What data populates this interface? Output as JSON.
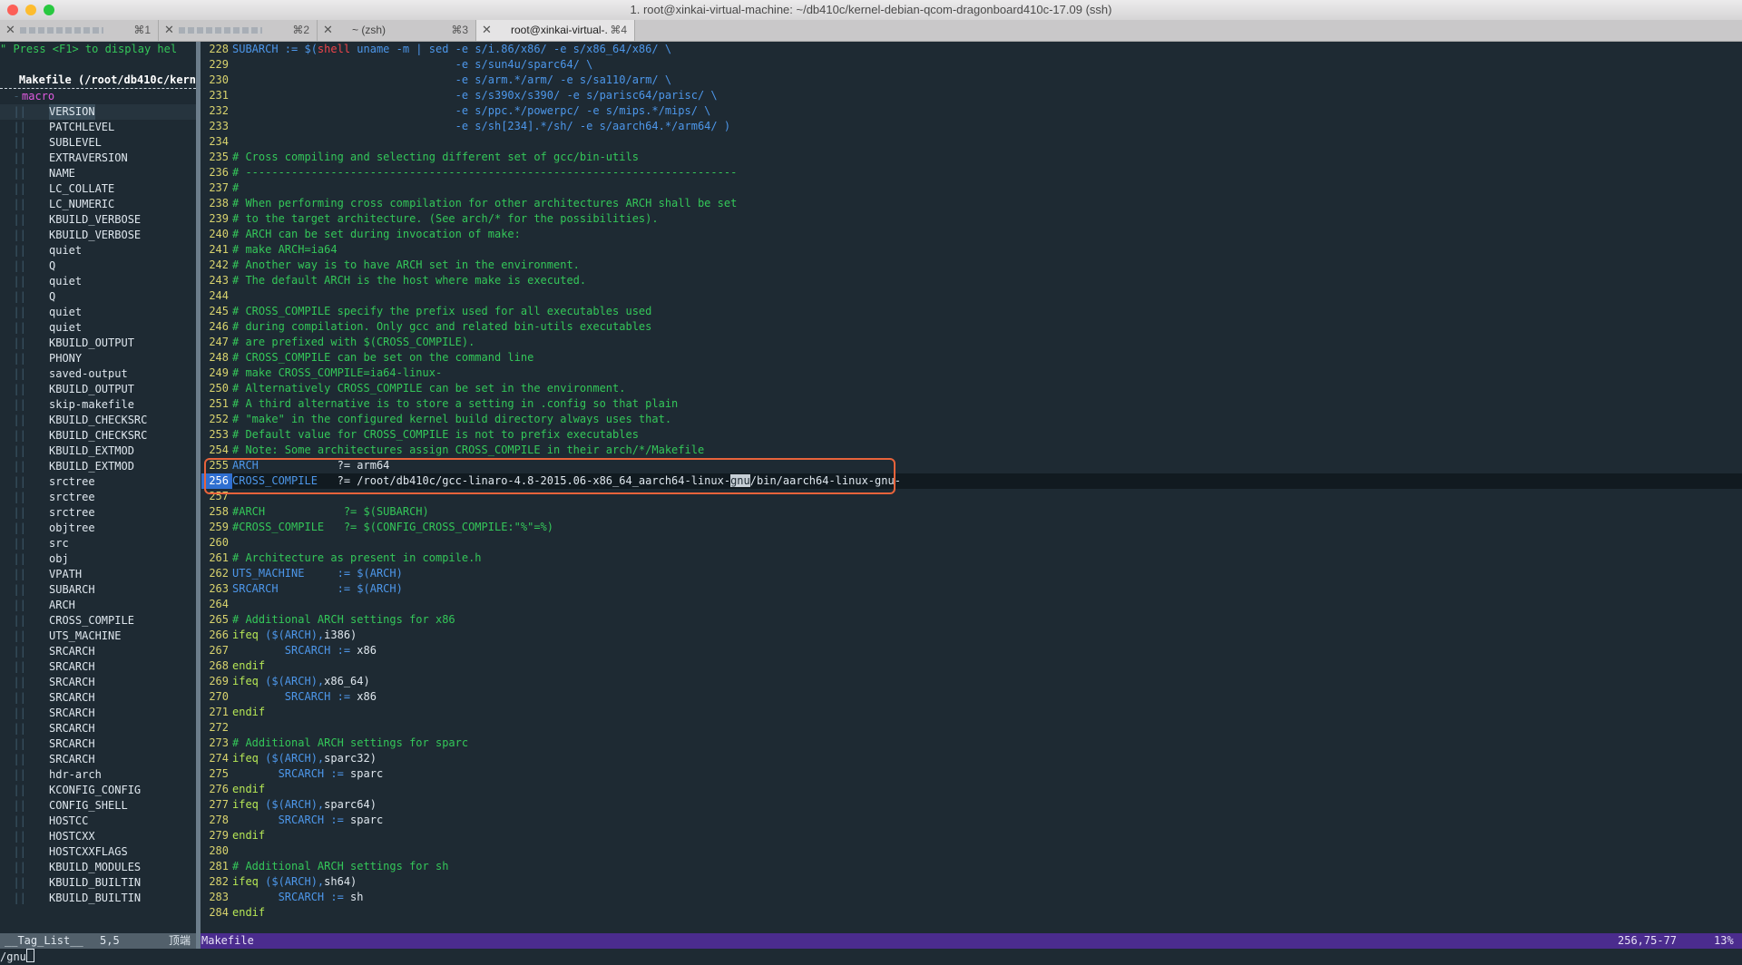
{
  "window": {
    "title": "1. root@xinkai-virtual-machine: ~/db410c/kernel-debian-qcom-dragonboard410c-17.09 (ssh)"
  },
  "tabs": [
    {
      "label": "",
      "shortcut": "⌘1",
      "active": false,
      "redacted": true
    },
    {
      "label": "",
      "shortcut": "⌘2",
      "active": false,
      "redacted": true
    },
    {
      "label": "~ (zsh)",
      "shortcut": "⌘3",
      "active": false,
      "redacted": false
    },
    {
      "label": "root@xinkai-virtual-...",
      "shortcut": "⌘4",
      "active": true,
      "redacted": false
    }
  ],
  "taglist": {
    "help": "\" Press <F1> to display hel",
    "file": "Makefile (/root/db410c/kern",
    "group": "macro",
    "items": [
      "VERSION",
      "PATCHLEVEL",
      "SUBLEVEL",
      "EXTRAVERSION",
      "NAME",
      "LC_COLLATE",
      "LC_NUMERIC",
      "KBUILD_VERBOSE",
      "KBUILD_VERBOSE",
      "quiet",
      "Q",
      "quiet",
      "Q",
      "quiet",
      "quiet",
      "KBUILD_OUTPUT",
      "PHONY",
      "saved-output",
      "KBUILD_OUTPUT",
      "skip-makefile",
      "KBUILD_CHECKSRC",
      "KBUILD_CHECKSRC",
      "KBUILD_EXTMOD",
      "KBUILD_EXTMOD",
      "srctree",
      "srctree",
      "srctree",
      "objtree",
      "src",
      "obj",
      "VPATH",
      "SUBARCH",
      "ARCH",
      "CROSS_COMPILE",
      "UTS_MACHINE",
      "SRCARCH",
      "SRCARCH",
      "SRCARCH",
      "SRCARCH",
      "SRCARCH",
      "SRCARCH",
      "SRCARCH",
      "SRCARCH",
      "hdr-arch",
      "KCONFIG_CONFIG",
      "CONFIG_SHELL",
      "HOSTCC",
      "HOSTCXX",
      "HOSTCXXFLAGS",
      "KBUILD_MODULES",
      "KBUILD_BUILTIN",
      "KBUILD_BUILTIN"
    ],
    "selected_index": 0
  },
  "editor": {
    "current_line": 256,
    "lines": [
      {
        "n": "228",
        "segs": [
          [
            "SUBARCH := $(",
            "#4d97ea"
          ],
          [
            "shell",
            "#f0444a"
          ],
          [
            " uname -m | sed -e s/i.86/x86/ -e s/x86_64/x86/ \\",
            "#4d97ea"
          ]
        ]
      },
      {
        "n": "229",
        "segs": [
          [
            "                                  -e s/sun4u/sparc64/ \\",
            "#4d97ea"
          ]
        ]
      },
      {
        "n": "230",
        "segs": [
          [
            "                                  -e s/arm.*/arm/ -e s/sa110/arm/ \\",
            "#4d97ea"
          ]
        ]
      },
      {
        "n": "231",
        "segs": [
          [
            "                                  -e s/s390x/s390/ -e s/parisc64/parisc/ \\",
            "#4d97ea"
          ]
        ]
      },
      {
        "n": "232",
        "segs": [
          [
            "                                  -e s/ppc.*/powerpc/ -e s/mips.*/mips/ \\",
            "#4d97ea"
          ]
        ]
      },
      {
        "n": "233",
        "segs": [
          [
            "                                  -e s/sh[234].*/sh/ -e s/aarch64.*/arm64/ )",
            "#4d97ea"
          ]
        ]
      },
      {
        "n": "234",
        "segs": []
      },
      {
        "n": "235",
        "segs": [
          [
            "# Cross compiling and selecting different set of gcc/bin-utils",
            "#34c759"
          ]
        ]
      },
      {
        "n": "236",
        "segs": [
          [
            "# ---------------------------------------------------------------------------",
            "#34c759"
          ]
        ]
      },
      {
        "n": "237",
        "segs": [
          [
            "#",
            "#34c759"
          ]
        ]
      },
      {
        "n": "238",
        "segs": [
          [
            "# When performing cross compilation for other architectures ARCH shall be set",
            "#34c759"
          ]
        ]
      },
      {
        "n": "239",
        "segs": [
          [
            "# to the target architecture. (See arch/* for the possibilities).",
            "#34c759"
          ]
        ]
      },
      {
        "n": "240",
        "segs": [
          [
            "# ARCH can be set during invocation of make:",
            "#34c759"
          ]
        ]
      },
      {
        "n": "241",
        "segs": [
          [
            "# make ARCH=ia64",
            "#34c759"
          ]
        ]
      },
      {
        "n": "242",
        "segs": [
          [
            "# Another way is to have ARCH set in the environment.",
            "#34c759"
          ]
        ]
      },
      {
        "n": "243",
        "segs": [
          [
            "# The default ARCH is the host where make is executed.",
            "#34c759"
          ]
        ]
      },
      {
        "n": "244",
        "segs": []
      },
      {
        "n": "245",
        "segs": [
          [
            "# CROSS_COMPILE specify the prefix used for all executables used",
            "#34c759"
          ]
        ]
      },
      {
        "n": "246",
        "segs": [
          [
            "# during compilation. Only gcc and related bin-utils executables",
            "#34c759"
          ]
        ]
      },
      {
        "n": "247",
        "segs": [
          [
            "# are prefixed with $(CROSS_COMPILE).",
            "#34c759"
          ]
        ]
      },
      {
        "n": "248",
        "segs": [
          [
            "# CROSS_COMPILE can be set on the command line",
            "#34c759"
          ]
        ]
      },
      {
        "n": "249",
        "segs": [
          [
            "# make CROSS_COMPILE=ia64-linux-",
            "#34c759"
          ]
        ]
      },
      {
        "n": "250",
        "segs": [
          [
            "# Alternatively CROSS_COMPILE can be set in the environment.",
            "#34c759"
          ]
        ]
      },
      {
        "n": "251",
        "segs": [
          [
            "# A third alternative is to store a setting in .config so that plain",
            "#34c759"
          ]
        ]
      },
      {
        "n": "252",
        "segs": [
          [
            "# \"make\" in the configured kernel build directory always uses that.",
            "#34c759"
          ]
        ]
      },
      {
        "n": "253",
        "segs": [
          [
            "# Default value for CROSS_COMPILE is not to prefix executables",
            "#34c759"
          ]
        ]
      },
      {
        "n": "254",
        "segs": [
          [
            "# Note: Some architectures assign CROSS_COMPILE in their arch/*/Makefile",
            "#34c759"
          ]
        ]
      },
      {
        "n": "255",
        "segs": [
          [
            "ARCH",
            "#4d97ea"
          ],
          [
            "            ?= arm64",
            "#dfe7ee"
          ]
        ]
      },
      {
        "n": "256",
        "segs": [
          [
            "CROSS_COMPILE",
            "#4d97ea"
          ],
          [
            "   ?= /root/db410c/gcc-linaro-4.8-2015.06-x86_64_aarch64-linux-",
            "#dfe7ee"
          ],
          [
            "gnu",
            "#1e2a33",
            "#c7cfd6"
          ],
          [
            "/bin/aarch64-linux-gnu-",
            "#dfe7ee"
          ]
        ]
      },
      {
        "n": "257",
        "segs": []
      },
      {
        "n": "258",
        "segs": [
          [
            "#ARCH            ?= $(SUBARCH)",
            "#34c759"
          ]
        ]
      },
      {
        "n": "259",
        "segs": [
          [
            "#CROSS_COMPILE   ?= $(CONFIG_CROSS_COMPILE:\"%\"=%)",
            "#34c759"
          ]
        ]
      },
      {
        "n": "260",
        "segs": []
      },
      {
        "n": "261",
        "segs": [
          [
            "# Architecture as present in compile.h",
            "#34c759"
          ]
        ]
      },
      {
        "n": "262",
        "segs": [
          [
            "UTS_MACHINE     := $(ARCH)",
            "#4d97ea"
          ]
        ]
      },
      {
        "n": "263",
        "segs": [
          [
            "SRCARCH         := $(ARCH)",
            "#4d97ea"
          ]
        ]
      },
      {
        "n": "264",
        "segs": []
      },
      {
        "n": "265",
        "segs": [
          [
            "# Additional ARCH settings for x86",
            "#34c759"
          ]
        ]
      },
      {
        "n": "266",
        "segs": [
          [
            "ifeq",
            "#b5e655"
          ],
          [
            " ($(ARCH),",
            "#4d97ea"
          ],
          [
            "i386)",
            "#dfe7ee"
          ]
        ]
      },
      {
        "n": "267",
        "segs": [
          [
            "        SRCARCH := ",
            "#4d97ea"
          ],
          [
            "x86",
            "#dfe7ee"
          ]
        ]
      },
      {
        "n": "268",
        "segs": [
          [
            "endif",
            "#b5e655"
          ]
        ]
      },
      {
        "n": "269",
        "segs": [
          [
            "ifeq",
            "#b5e655"
          ],
          [
            " ($(ARCH),",
            "#4d97ea"
          ],
          [
            "x86_64)",
            "#dfe7ee"
          ]
        ]
      },
      {
        "n": "270",
        "segs": [
          [
            "        SRCARCH := ",
            "#4d97ea"
          ],
          [
            "x86",
            "#dfe7ee"
          ]
        ]
      },
      {
        "n": "271",
        "segs": [
          [
            "endif",
            "#b5e655"
          ]
        ]
      },
      {
        "n": "272",
        "segs": []
      },
      {
        "n": "273",
        "segs": [
          [
            "# Additional ARCH settings for sparc",
            "#34c759"
          ]
        ]
      },
      {
        "n": "274",
        "segs": [
          [
            "ifeq",
            "#b5e655"
          ],
          [
            " ($(ARCH),",
            "#4d97ea"
          ],
          [
            "sparc32)",
            "#dfe7ee"
          ]
        ]
      },
      {
        "n": "275",
        "segs": [
          [
            "       SRCARCH := ",
            "#4d97ea"
          ],
          [
            "sparc",
            "#dfe7ee"
          ]
        ]
      },
      {
        "n": "276",
        "segs": [
          [
            "endif",
            "#b5e655"
          ]
        ]
      },
      {
        "n": "277",
        "segs": [
          [
            "ifeq",
            "#b5e655"
          ],
          [
            " ($(ARCH),",
            "#4d97ea"
          ],
          [
            "sparc64)",
            "#dfe7ee"
          ]
        ]
      },
      {
        "n": "278",
        "segs": [
          [
            "       SRCARCH := ",
            "#4d97ea"
          ],
          [
            "sparc",
            "#dfe7ee"
          ]
        ]
      },
      {
        "n": "279",
        "segs": [
          [
            "endif",
            "#b5e655"
          ]
        ]
      },
      {
        "n": "280",
        "segs": []
      },
      {
        "n": "281",
        "segs": [
          [
            "# Additional ARCH settings for sh",
            "#34c759"
          ]
        ]
      },
      {
        "n": "282",
        "segs": [
          [
            "ifeq",
            "#b5e655"
          ],
          [
            " ($(ARCH),",
            "#4d97ea"
          ],
          [
            "sh64)",
            "#dfe7ee"
          ]
        ]
      },
      {
        "n": "283",
        "segs": [
          [
            "       SRCARCH := ",
            "#4d97ea"
          ],
          [
            "sh",
            "#dfe7ee"
          ]
        ]
      },
      {
        "n": "284",
        "segs": [
          [
            "endif",
            "#b5e655"
          ]
        ]
      }
    ]
  },
  "statusbar": {
    "left_name": "__Tag_List__",
    "left_pos": "5,5",
    "left_top": "顶端",
    "file": "Makefile",
    "position": "256,75-77",
    "percent": "13%"
  },
  "cmdline": {
    "text": "/gnu"
  },
  "colors": {
    "background": "#1e2a33",
    "comment": "#34c759",
    "keyword": "#b5e655",
    "identifier": "#4d97ea",
    "line_number": "#d9d36e",
    "statusbar_active": "#4b2c8e",
    "highlight_box": "#e8633b"
  }
}
